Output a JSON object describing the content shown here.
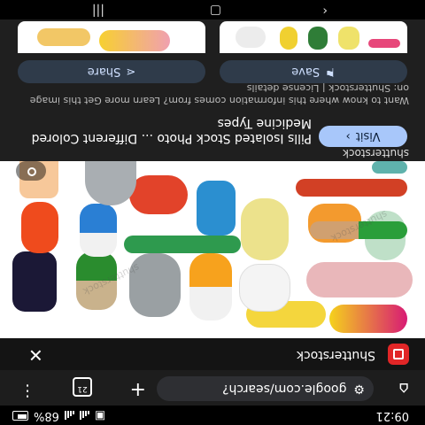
{
  "status_bar": {
    "time": "09:21",
    "battery_pct": "68%"
  },
  "url_bar": {
    "url": "google.com/search?",
    "tab_count": "21"
  },
  "site_row": {
    "site_name": "Shutterstock"
  },
  "image": {
    "watermark": "shutterstock"
  },
  "info": {
    "source": "shutterstock",
    "visit_label": "Visit",
    "title": "Pills Isolated Stock Photo ... Different Colored Medicine Types",
    "license": "Want to know where this information comes from? Learn more Get this image on: Shutterstock | License details",
    "share_label": "Share",
    "save_label": "Save"
  },
  "colors": {
    "accent": "#a8c7fa",
    "brand": "#e12627",
    "background": "#1f1f1f"
  }
}
